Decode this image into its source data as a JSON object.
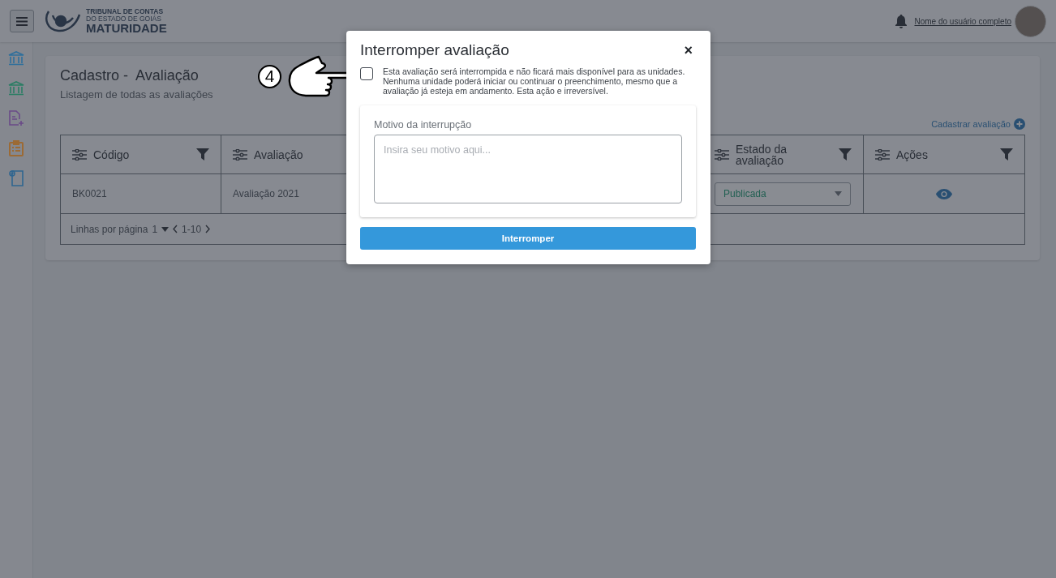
{
  "header": {
    "brand_line1": "TRIBUNAL DE CONTAS",
    "brand_line2": "DO ESTADO DE GOIÁS",
    "brand_name": "MATURIDADE",
    "user_name": "Nome do usuário completo"
  },
  "sidebar": {
    "items": [
      {
        "kind": "bank",
        "color": "#2f6f9c"
      },
      {
        "kind": "bank",
        "color": "#2b7d64"
      },
      {
        "kind": "document-add",
        "color": "#6a4a88"
      },
      {
        "kind": "clipboard",
        "color": "#9c6a34"
      },
      {
        "kind": "note",
        "color": "#2f6690"
      }
    ]
  },
  "page": {
    "title": "Cadastro -  Avaliação",
    "subtitle": "Listagem de todas as avaliações",
    "add_link": "Cadastrar avaliação",
    "table": {
      "columns": [
        {
          "label": "Código"
        },
        {
          "label": "Avaliação"
        },
        {
          "label": "Estado da avaliação"
        },
        {
          "label": "Ações"
        }
      ],
      "rows": [
        {
          "code": "BK0021",
          "name": "Avaliação 2021",
          "status": "Publicada"
        }
      ]
    },
    "pagination": {
      "label": "Linhas por  página",
      "per_page": "1",
      "range": "1-10"
    }
  },
  "modal": {
    "title": "Interromper avaliação",
    "close": "×",
    "checked": false,
    "message": "Esta avaliação será interrompida e não ficará mais disponível para as unidades. Nenhuma unidade poderá iniciar ou continuar o preenchimento, mesmo que a avaliação já esteja em andamento. Esta ação e irreversível.",
    "reason_label": "Motivo da interrupção",
    "reason_placeholder": "Insira seu motivo aqui...",
    "button": "Interromper"
  },
  "annotation": {
    "step": "4"
  }
}
